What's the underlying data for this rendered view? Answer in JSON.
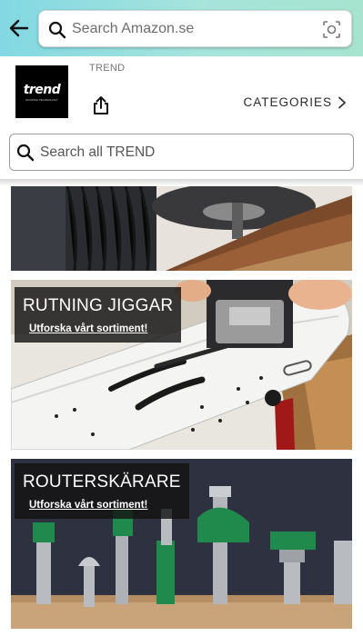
{
  "header": {
    "back_icon": "back-arrow-icon",
    "search": {
      "placeholder": "Search Amazon.se",
      "value": ""
    },
    "camera_icon": "camera-lens-icon",
    "background_gradient": [
      "#82d8e3",
      "#a7e4cf"
    ]
  },
  "store": {
    "brand_label": "TREND",
    "logo_text": "trend",
    "logo_tagline": "ROUTING TECHNOLOGY",
    "share_icon": "share-icon",
    "categories_label": "CATEGORIES",
    "search": {
      "placeholder": "Search all TREND",
      "value": ""
    }
  },
  "tiles": [
    {
      "name": "router-workshop-image"
    },
    {
      "title": "RUTNING JIGGAR",
      "link": "Utforska vårt sortiment!"
    },
    {
      "title": "ROUTERSKÄRARE",
      "link": "Utforska vårt sortiment!"
    }
  ],
  "colors": {
    "overlay": "#141414",
    "bit_green": "#1f8a4c",
    "jig_white": "#f4f4f2"
  }
}
